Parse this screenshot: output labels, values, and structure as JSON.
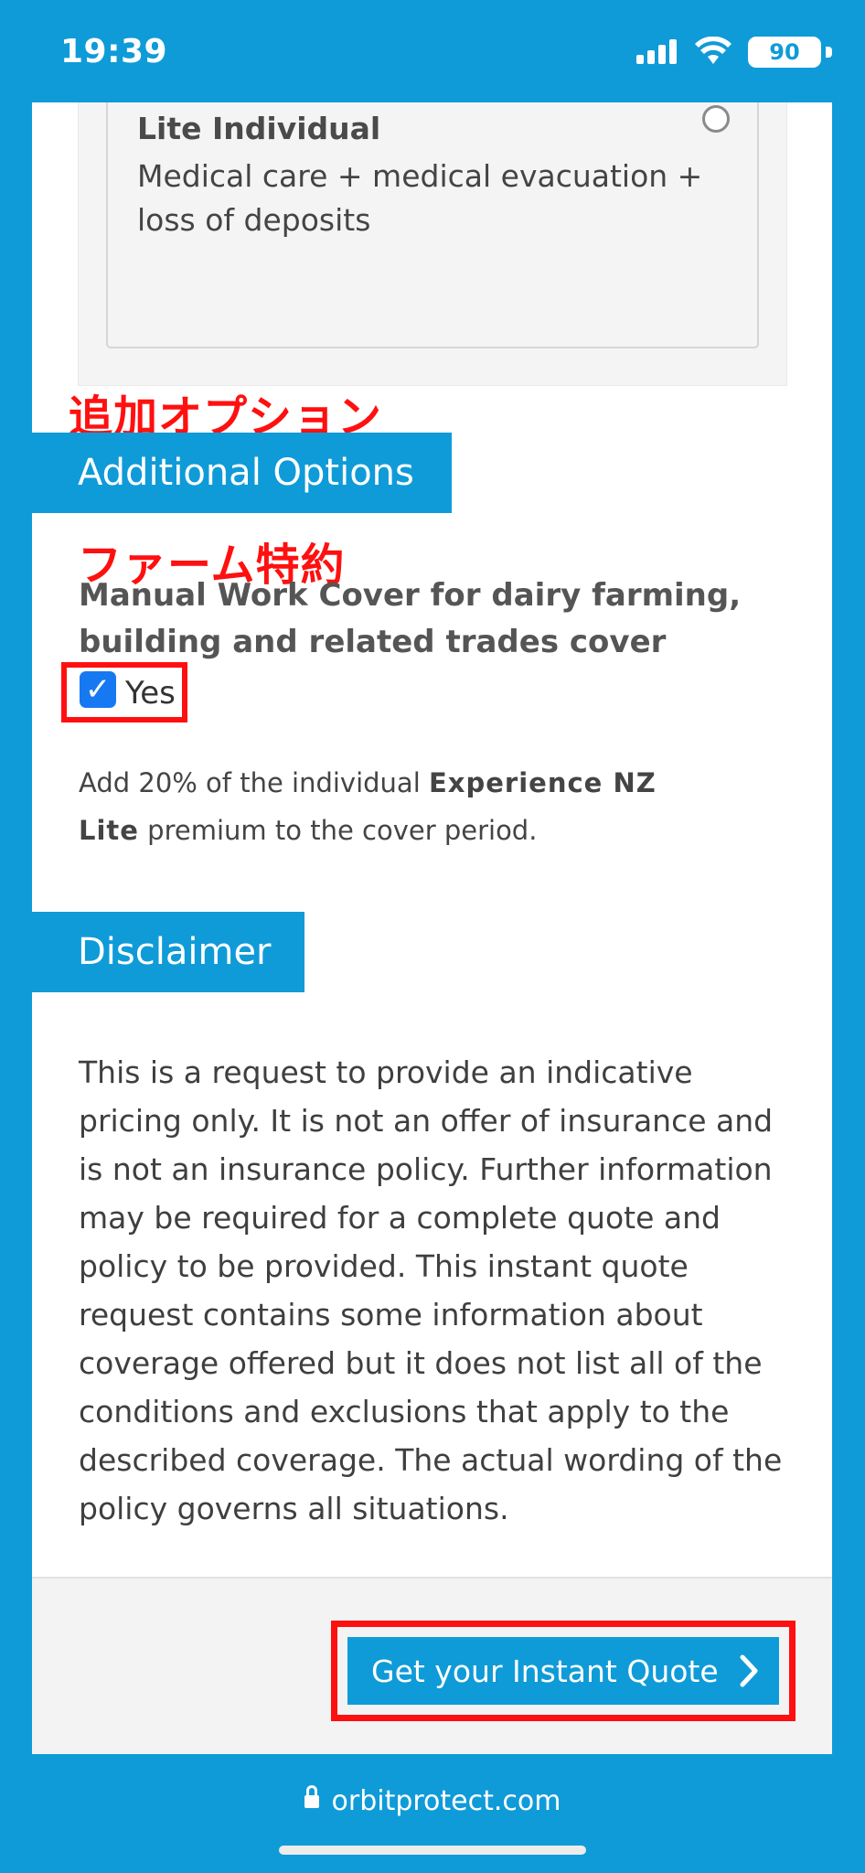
{
  "status_bar": {
    "time": "19:39",
    "battery_level": "90",
    "icons": [
      "signal-icon",
      "wifi-icon",
      "battery-icon"
    ]
  },
  "plan": {
    "title": "Lite Individual",
    "description": "Medical care + medical evacuation + loss of deposits",
    "selected": false
  },
  "annotations": {
    "additional_options_jp": "追加オプション",
    "farm_jp": "ファーム特約"
  },
  "additional_options": {
    "header": "Additional Options",
    "option_label": "Manual Work Cover for dairy farming, building and related trades cover",
    "checkbox_label": "Yes",
    "checked": true,
    "note_prefix": "Add 20% of the individual ",
    "note_bold": "Experience NZ Lite",
    "note_suffix": " premium to the cover period."
  },
  "disclaimer": {
    "header": "Disclaimer",
    "text": "This is a request to provide an indicative pricing only. It is not an offer of insurance and is not an insurance policy. Further information may be required for a complete quote and policy to be provided. This instant quote request contains some information about coverage offered but it does not list all of the conditions and exclusions that apply to the described coverage. The actual wording of the policy governs all situations."
  },
  "cta": {
    "label": "Get your Instant Quote"
  },
  "browser": {
    "url": "orbitprotect.com"
  },
  "colors": {
    "brand_blue": "#0f9bd8",
    "annotation_red": "#ff1010",
    "checkbox_blue": "#1679f2"
  }
}
